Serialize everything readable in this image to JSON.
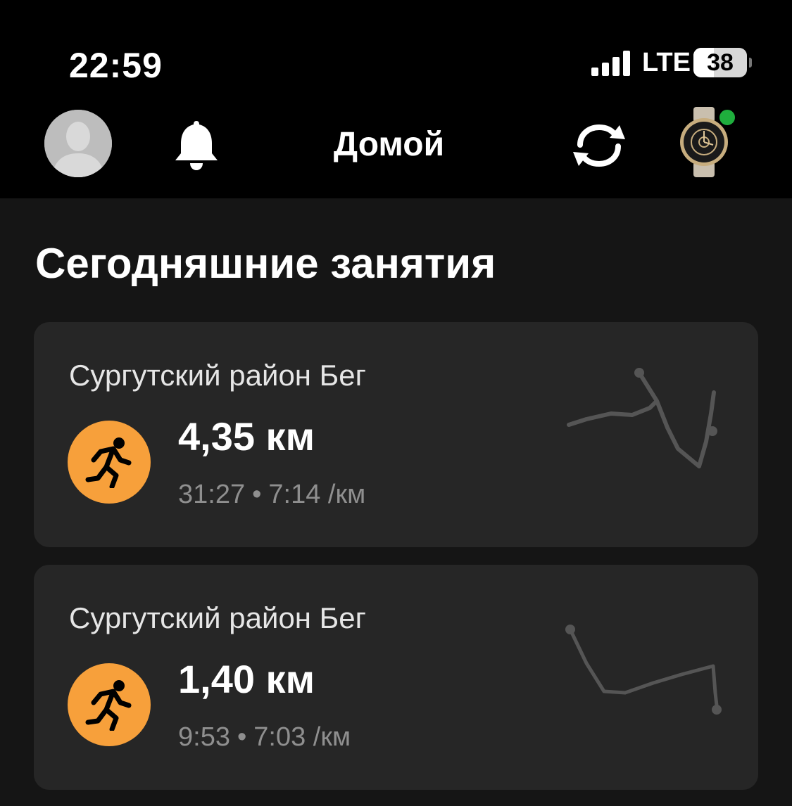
{
  "status_bar": {
    "time": "22:59",
    "network": "LTE",
    "battery_percent": "38",
    "battery_level": 0.38
  },
  "header": {
    "title": "Домой",
    "avatar_icon": "user-avatar-placeholder",
    "notifications_icon": "bell-icon",
    "sync_icon": "sync-icon",
    "device_icon": "watch-icon",
    "device_status_color": "#1fae3d"
  },
  "main": {
    "section_title": "Сегодняшние занятия",
    "activities": [
      {
        "title": "Сургутский район Бег",
        "distance": "4,35 км",
        "duration": "31:27",
        "pace": "7:14 /км",
        "icon": "running-icon",
        "icon_color": "#f7a03b"
      },
      {
        "title": "Сургутский район Бег",
        "distance": "1,40 км",
        "duration": "9:53",
        "pace": "7:03 /км",
        "icon": "running-icon",
        "icon_color": "#f7a03b"
      }
    ]
  },
  "colors": {
    "background": "#151515",
    "card": "#262626",
    "accent": "#f7a03b",
    "route": "#555555"
  }
}
